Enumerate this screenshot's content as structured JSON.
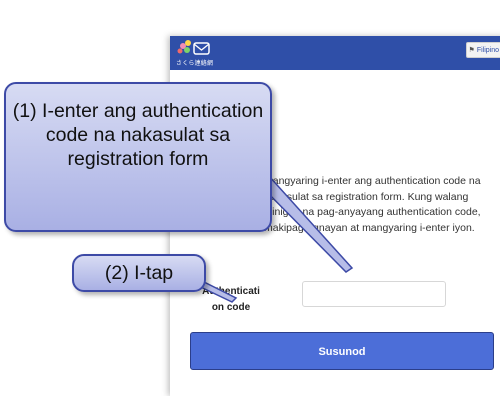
{
  "header": {
    "logo_text": "さくら連絡網",
    "language_button": "Filipino",
    "language_icon": "flag-icon"
  },
  "main": {
    "instructions": "Mangyaring i-enter ang authentication code na nakasulat sa registration form. Kung walang ibinigay na pag-anyayang authentication code, makipag-ugnayan at mangyaring i-enter iyon.",
    "code_label": "Authentication code",
    "code_value": "",
    "next_button": "Susunod"
  },
  "callouts": {
    "step1": "(1) I-enter ang authentication code na nakasulat sa registration form",
    "step2": "(2) I-tap"
  },
  "colors": {
    "appbar": "#2f4fa8",
    "button": "#4c6ed8",
    "callout_border": "#3d4aa6"
  }
}
